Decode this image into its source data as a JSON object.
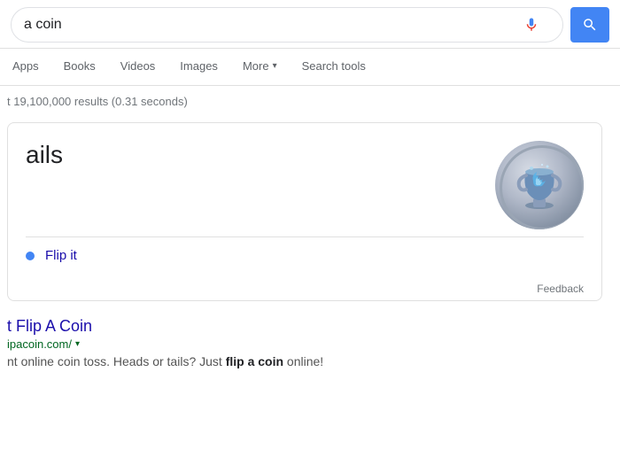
{
  "search": {
    "query": "a coin",
    "mic_label": "mic",
    "search_button_label": "search"
  },
  "nav": {
    "tabs": [
      {
        "id": "apps",
        "label": "Apps",
        "active": false
      },
      {
        "id": "books",
        "label": "Books",
        "active": false
      },
      {
        "id": "videos",
        "label": "Videos",
        "active": false
      },
      {
        "id": "images",
        "label": "Images",
        "active": false
      },
      {
        "id": "more",
        "label": "More",
        "active": false,
        "has_dropdown": true
      },
      {
        "id": "search-tools",
        "label": "Search tools",
        "active": false
      }
    ]
  },
  "results": {
    "count_text": "t 19,100,000 results (0.31 seconds)"
  },
  "knowledge_card": {
    "title": "ails",
    "flip_it_label": "Flip it",
    "feedback_label": "Feedback"
  },
  "search_result": {
    "title": "t Flip A Coin",
    "url": "ipacoin.com/",
    "snippet": "nt online coin toss. Heads or tails? Just ",
    "snippet_bold": "flip a coin",
    "snippet_end": " online!"
  }
}
